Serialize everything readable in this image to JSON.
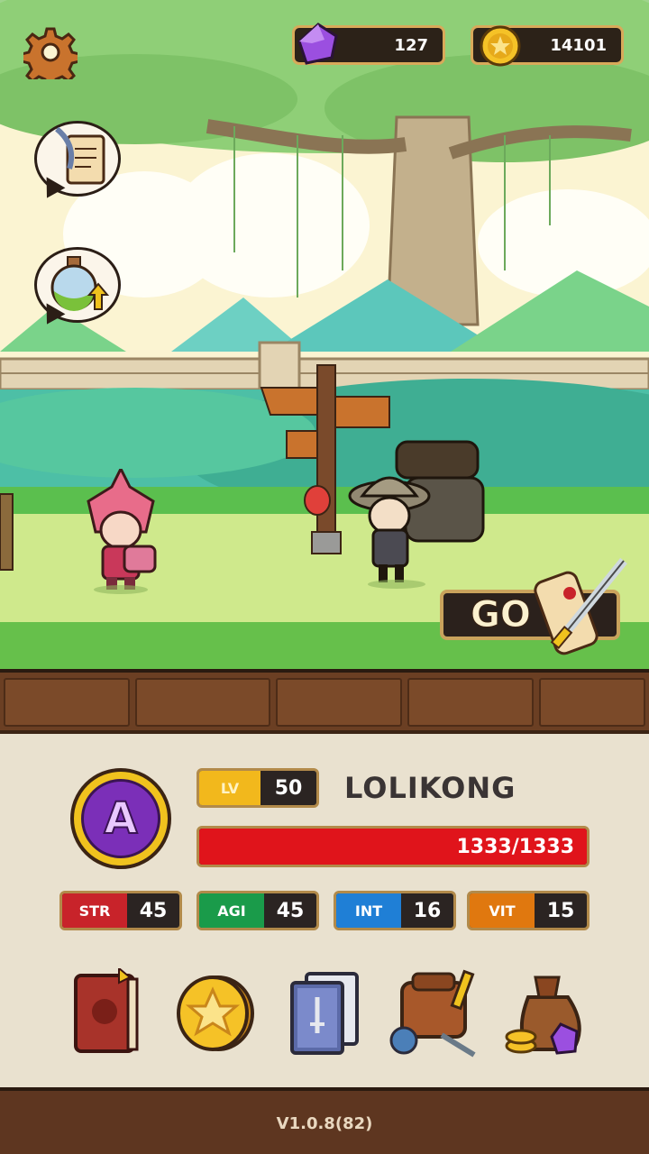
{
  "currency": {
    "gems": "127",
    "gold": "14101"
  },
  "hero": {
    "rank_letter": "A",
    "lv_label": "LV",
    "level": "50",
    "name": "LOLIKONG",
    "hp_text": "1333/1333",
    "hp_fraction": 1.0
  },
  "stats": [
    {
      "label": "STR",
      "value": "45",
      "color": "#c8232a"
    },
    {
      "label": "AGI",
      "value": "45",
      "color": "#1a9b4a"
    },
    {
      "label": "INT",
      "value": "16",
      "color": "#1f7fd6"
    },
    {
      "label": "VIT",
      "value": "15",
      "color": "#e0780f"
    }
  ],
  "go_button": "GO",
  "version": "V1.0.8(82)",
  "icons": {
    "settings": "gear-icon",
    "quest": "quest-scroll-icon",
    "potion": "potion-upgrade-icon",
    "gem": "purple-gem-icon",
    "coin": "gold-coin-icon",
    "menu": [
      "book-icon",
      "star-coin-icon",
      "cards-icon",
      "inventory-bag-icon",
      "treasure-bag-icon"
    ]
  },
  "colors": {
    "hp_bar": "#e0141b",
    "lv_badge": "#f2b81c",
    "panel_bg": "#e9e1cf",
    "rank_purple": "#7b2fb8"
  }
}
